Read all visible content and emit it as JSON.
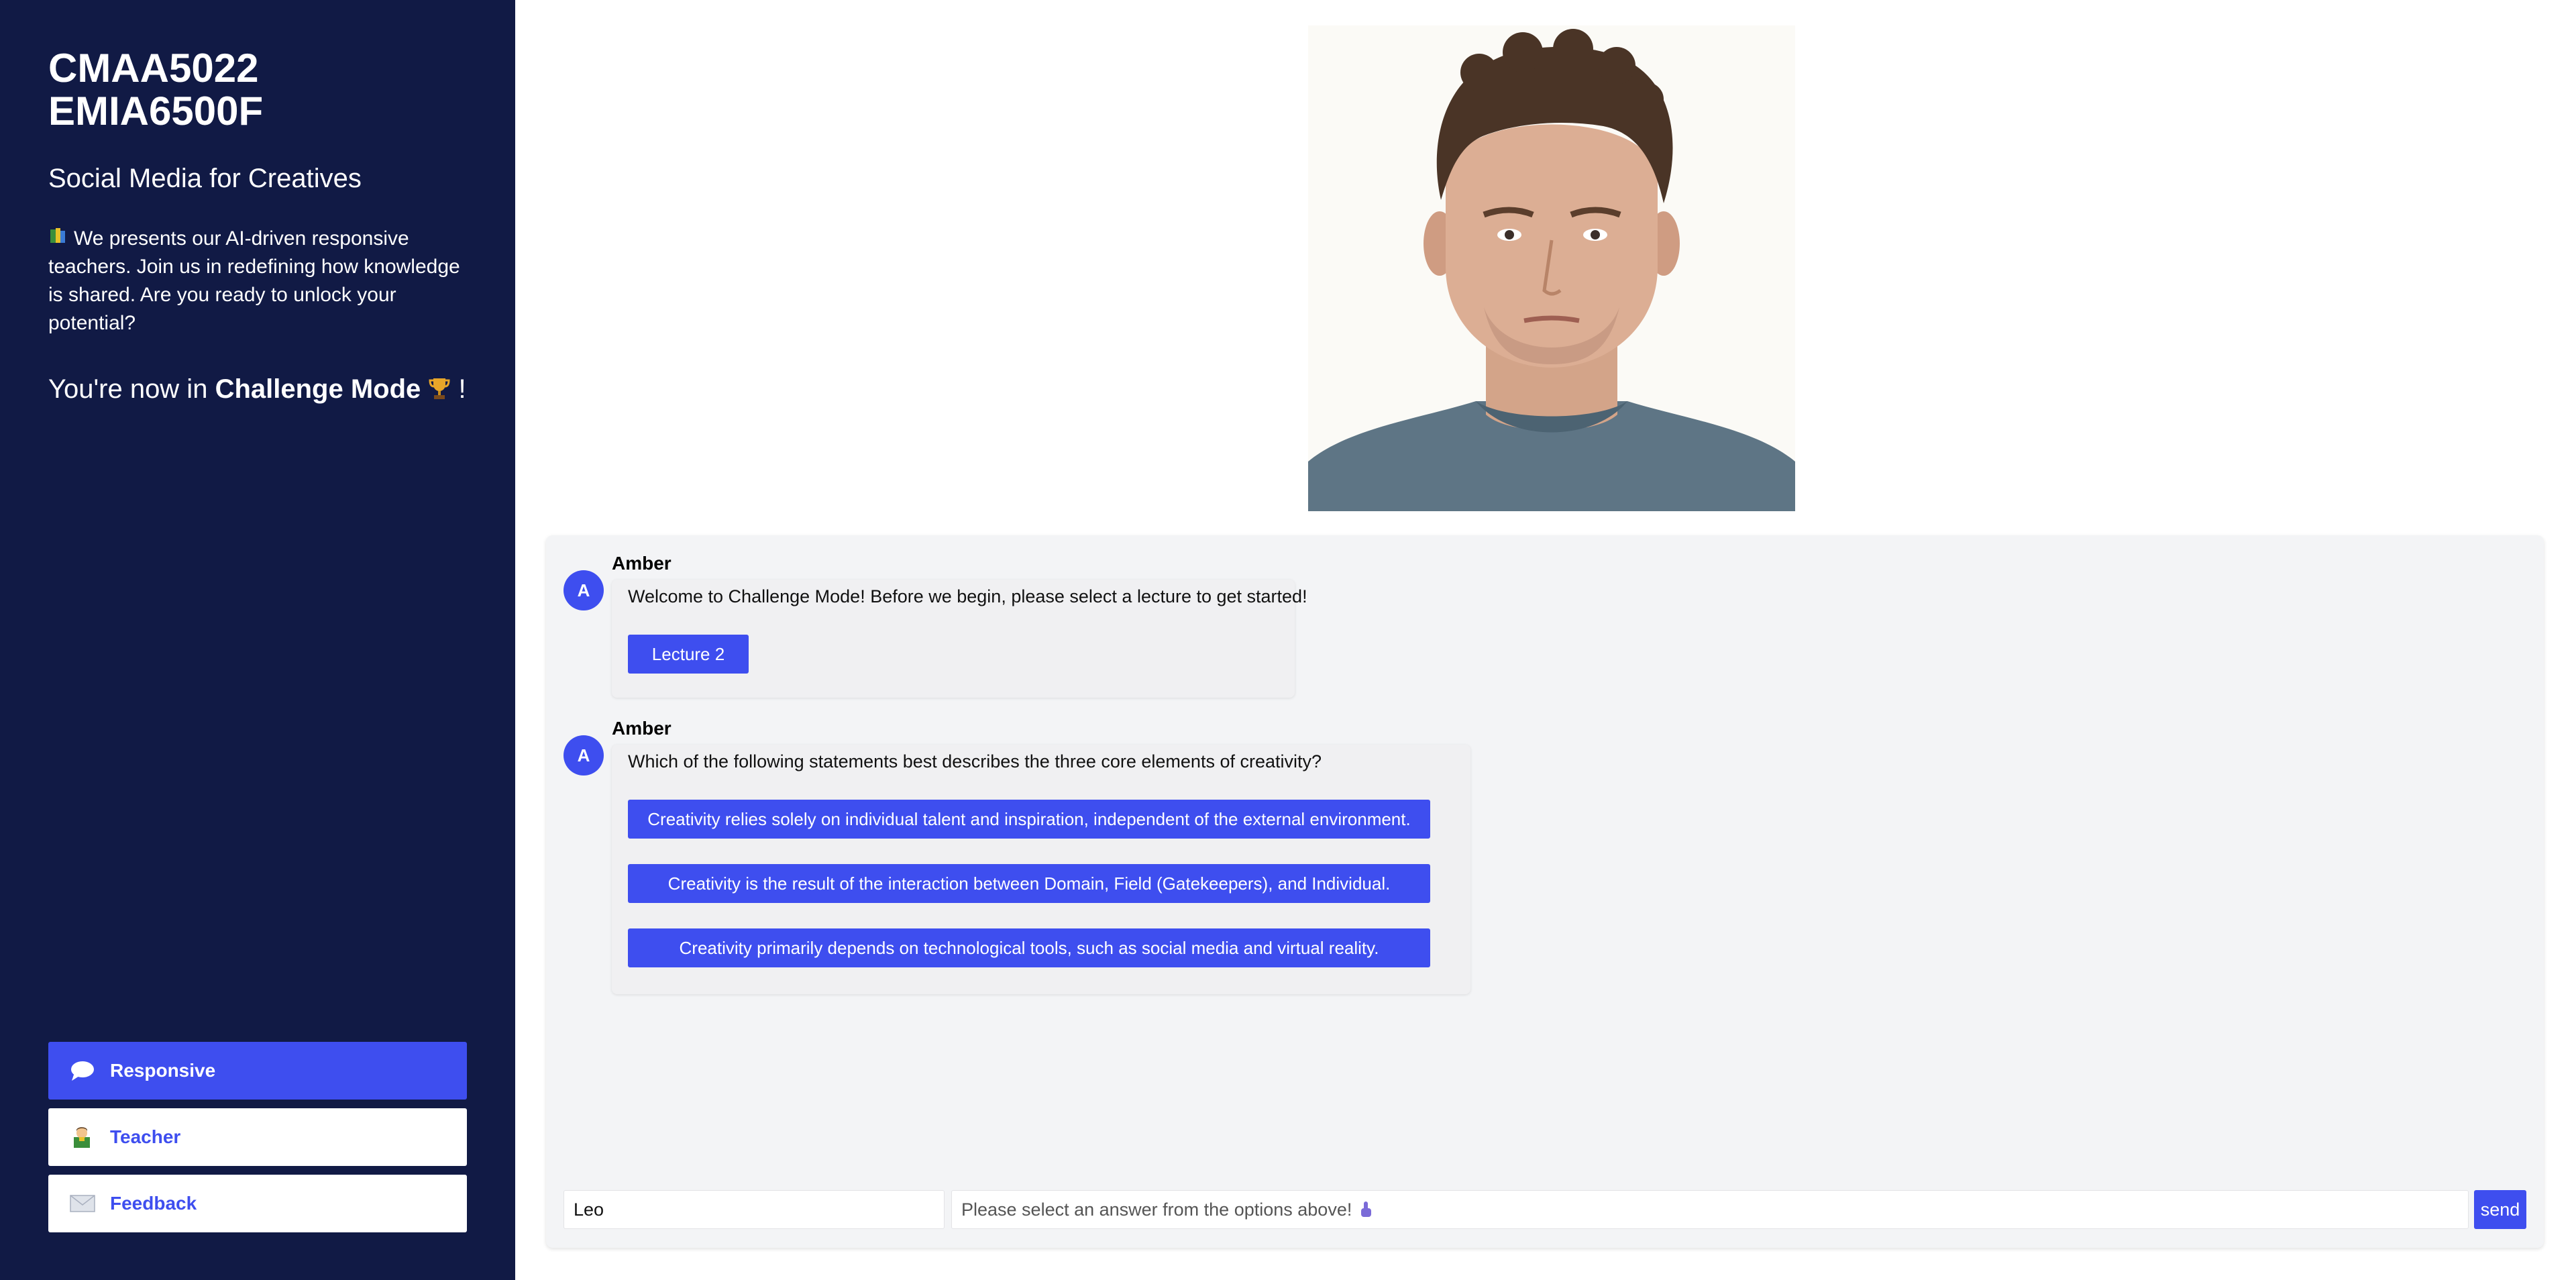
{
  "sidebar": {
    "course_code_line1": "CMAA5022",
    "course_code_line2": "EMIA6500F",
    "course_title": "Social Media for Creatives",
    "intro_icon": "books-icon",
    "intro_text": "We presents our AI-driven responsive teachers. Join us in redefining how knowledge is shared. Are you ready to unlock your potential?",
    "mode_prefix": "You're now in ",
    "mode_name": "Challenge Mode",
    "mode_icon": "trophy-icon",
    "mode_suffix": " !",
    "nav": [
      {
        "label": "Responsive",
        "icon": "speech-bubble-icon",
        "active": true
      },
      {
        "label": "Teacher",
        "icon": "teacher-icon",
        "active": false
      },
      {
        "label": "Feedback",
        "icon": "envelope-icon",
        "active": false
      }
    ]
  },
  "avatar_image": {
    "description_icon": "teacher-avatar-photo"
  },
  "chat": {
    "messages": [
      {
        "avatar_letter": "A",
        "sender": "Amber",
        "text": "Welcome to Challenge Mode! Before we begin, please select a lecture to get started!",
        "options": [
          "Lecture 2"
        ]
      },
      {
        "avatar_letter": "A",
        "sender": "Amber",
        "text": "Which of the following statements best describes the three core elements of creativity?",
        "options": [
          "Creativity relies solely on individual talent and inspiration, independent of the external environment.",
          "Creativity is the result of the interaction between Domain, Field (Gatekeepers), and Individual.",
          "Creativity primarily depends on technological tools, such as social media and virtual reality."
        ]
      }
    ],
    "name_value": "Leo",
    "message_placeholder": "Please select an answer from the options above!",
    "message_placeholder_icon": "pointing-up-icon",
    "send_label": "send"
  },
  "colors": {
    "sidebar_bg": "#111a45",
    "accent": "#3e4eef",
    "chat_panel_bg": "#f3f4f6"
  }
}
